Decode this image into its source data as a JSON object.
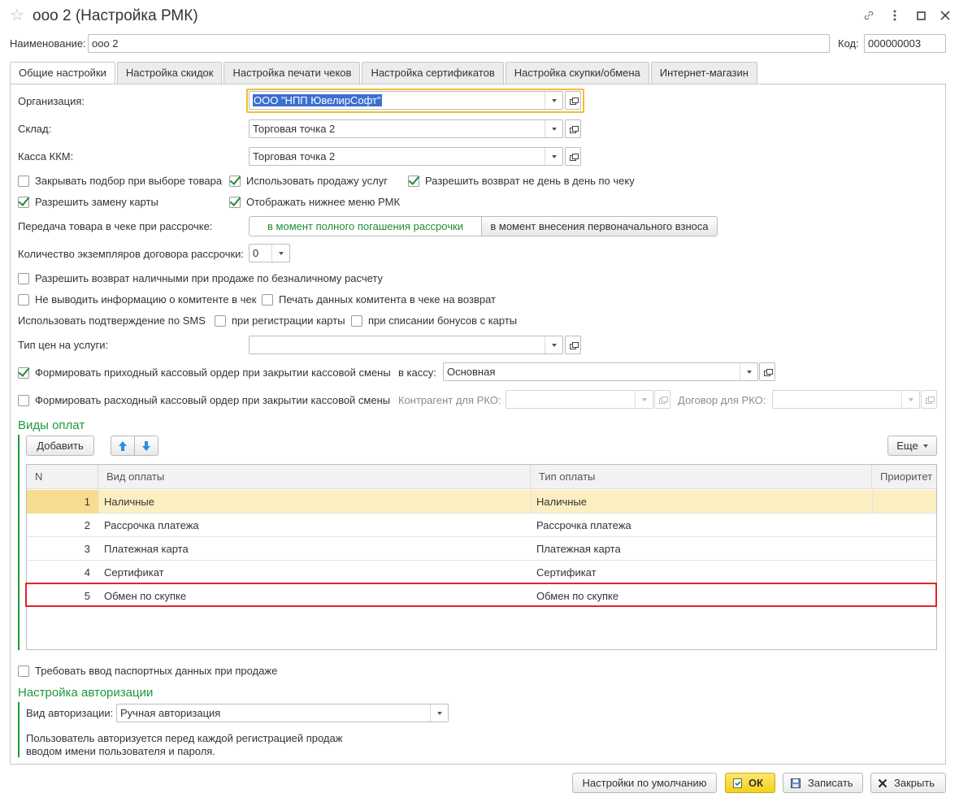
{
  "window": {
    "title": "ооо 2 (Настройка РМК)"
  },
  "header": {
    "name_label": "Наименование:",
    "name_value": "ооо 2",
    "code_label": "Код:",
    "code_value": "000000003"
  },
  "tabs": [
    {
      "label": "Общие настройки",
      "active": true
    },
    {
      "label": "Настройка скидок"
    },
    {
      "label": "Настройка печати чеков"
    },
    {
      "label": "Настройка сертификатов"
    },
    {
      "label": "Настройка скупки/обмена"
    },
    {
      "label": "Интернет-магазин"
    }
  ],
  "general": {
    "org_label": "Организация:",
    "org_value": "ООО \"НПП ЮвелирСофт\"",
    "warehouse_label": "Склад:",
    "warehouse_value": "Торговая точка 2",
    "kkm_label": "Касса ККМ:",
    "kkm_value": "Торговая точка 2",
    "cb_close_selection": "Закрывать подбор при выборе товара",
    "cb_use_services": "Использовать продажу услуг",
    "cb_allow_return": "Разрешить возврат не день в день по чеку",
    "cb_allow_card_replace": "Разрешить замену карты",
    "cb_show_bottom_menu": "Отображать нижнее меню РМК",
    "transfer_label": "Передача товара в чеке при рассрочке:",
    "transfer_opt1": "в момент полного погашения рассрочки",
    "transfer_opt2": "в момент внесения первоначального взноса",
    "copies_label": "Количество экземпляров договора рассрочки:",
    "copies_value": "0",
    "cb_cash_return": "Разрешить возврат наличными при продаже по безналичному расчету",
    "cb_no_committent_info": "Не выводить информацию о комитенте в чек",
    "cb_print_committent": "Печать данных комитента в чеке на возврат",
    "sms_label": "Использовать подтверждение по SMS",
    "cb_sms_registration": "при регистрации карты",
    "cb_sms_bonus": "при списании бонусов с карты",
    "price_type_label": "Тип цен на услуги:",
    "price_type_value": "",
    "cb_income_order": "Формировать приходный кассовый ордер при закрытии кассовой смены",
    "to_cashbox_label": "в кассу:",
    "cashbox_value": "Основная",
    "cb_expense_order": "Формировать расходный кассовый ордер при закрытии кассовой смены",
    "contractor_label": "Контрагент для РКО:",
    "contract_label": "Договор для РКО:"
  },
  "payments": {
    "section_title": "Виды оплат",
    "add_button": "Добавить",
    "more_button": "Еще",
    "columns": [
      "N",
      "Вид оплаты",
      "Тип оплаты",
      "Приоритет"
    ],
    "rows": [
      {
        "n": "1",
        "kind": "Наличные",
        "type": "Наличные"
      },
      {
        "n": "2",
        "kind": "Рассрочка платежа",
        "type": "Рассрочка платежа"
      },
      {
        "n": "3",
        "kind": "Платежная карта",
        "type": "Платежная карта"
      },
      {
        "n": "4",
        "kind": "Сертификат",
        "type": "Сертификат"
      },
      {
        "n": "5",
        "kind": "Обмен по скупке",
        "type": "Обмен по скупке"
      }
    ]
  },
  "passport": {
    "cb_require_passport": "Требовать ввод паспортных данных при продаже"
  },
  "auth": {
    "section_title": "Настройка авторизации",
    "kind_label": "Вид авторизации:",
    "kind_value": "Ручная авторизация",
    "description_line1": "Пользователь авторизуется перед каждой регистрацией продаж",
    "description_line2": "вводом имени пользователя и пароля."
  },
  "footer": {
    "defaults_button": "Настройки по умолчанию",
    "ok_button": "ОК",
    "save_button": "Записать",
    "close_button": "Закрыть"
  },
  "colors": {
    "accent_green": "#1d9a3a",
    "selected_row": "#fbefc2",
    "ok_yellow": "#f9e02b",
    "highlight_red": "#e2232a"
  }
}
